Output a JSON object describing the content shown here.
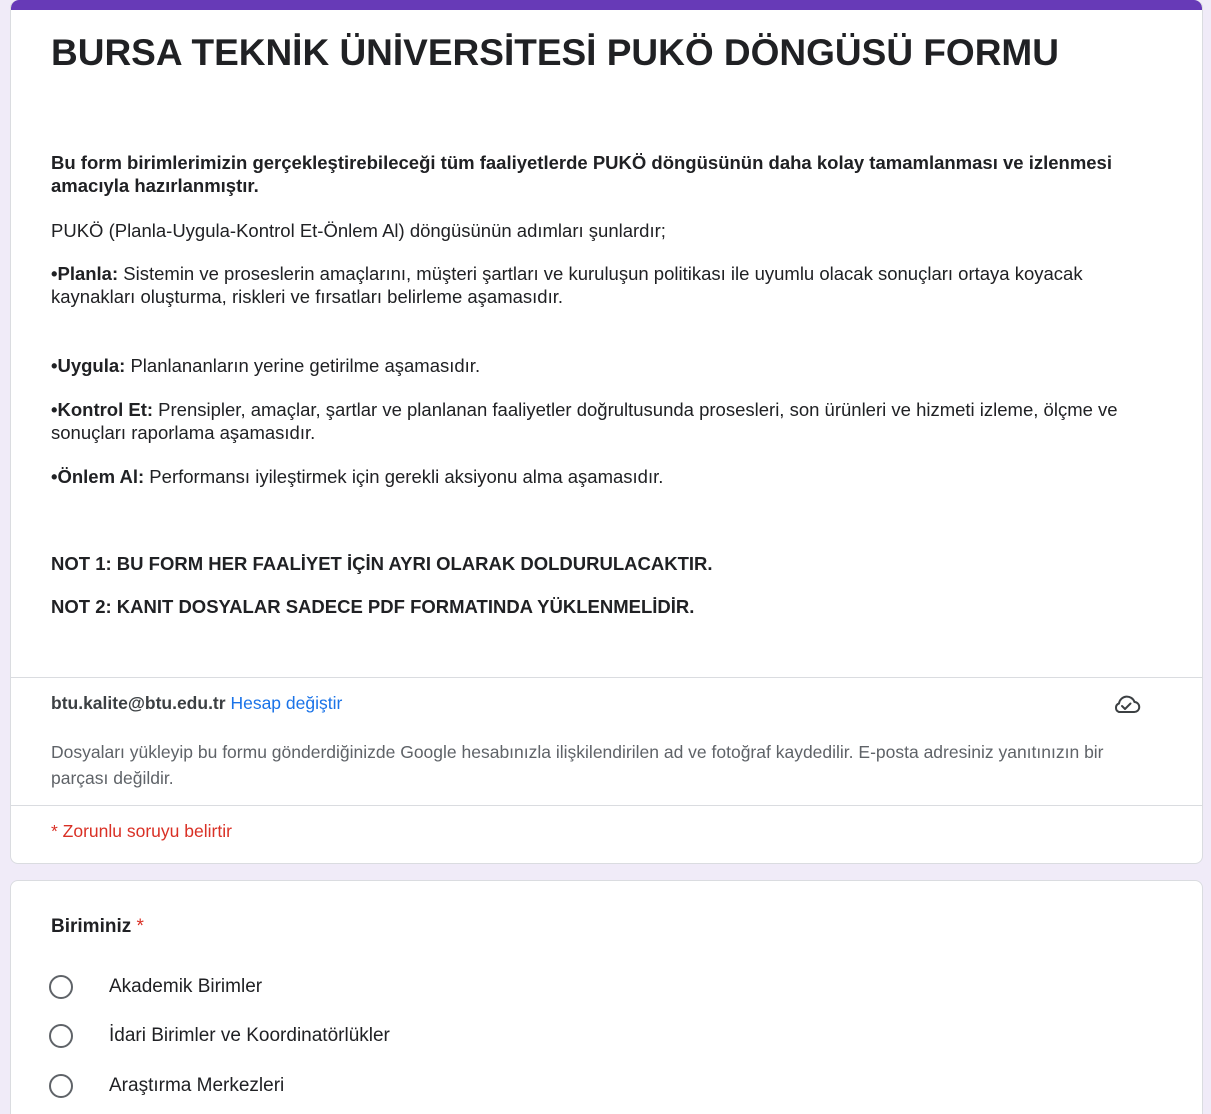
{
  "form": {
    "title": "BURSA TEKNİK ÜNİVERSİTESİ PUKÖ DÖNGÜSÜ FORMU",
    "intro_bold": "Bu form birimlerimizin gerçekleştirebileceği tüm faaliyetlerde PUKÖ döngüsünün daha kolay tamamlanması ve izlenmesi amacıyla hazırlanmıştır.",
    "intro": "PUKÖ (Planla-Uygula-Kontrol Et-Önlem Al) döngüsünün adımları şunlardır;",
    "steps": [
      {
        "label": "•Planla:",
        "text": " Sistemin ve proseslerin amaçlarını, müşteri şartları ve kuruluşun politikası ile uyumlu olacak sonuçları ortaya koyacak kaynakları oluşturma, riskleri ve fırsatları belirleme aşamasıdır."
      },
      {
        "label": "•Uygula:",
        "text": " Planlananların yerine getirilme aşamasıdır."
      },
      {
        "label": "•Kontrol Et:",
        "text": " Prensipler, amaçlar, şartlar ve planlanan faaliyetler doğrultusunda prosesleri, son ürünleri ve hizmeti izleme, ölçme ve sonuçları raporlama aşamasıdır."
      },
      {
        "label": "•Önlem Al:",
        "text": " Performansı iyileştirmek için gerekli aksiyonu alma aşamasıdır."
      }
    ],
    "note1": "NOT 1: BU FORM HER FAALİYET İÇİN AYRI OLARAK DOLDURULACAKTIR.",
    "note2": "NOT 2: KANIT DOSYALAR SADECE PDF FORMATINDA YÜKLENMELİDİR."
  },
  "account": {
    "email": "btu.kalite@btu.edu.tr",
    "switch_label": "Hesap değiştir",
    "status_icon": "cloud-check-icon",
    "privacy_note": "Dosyaları yükleyip bu formu gönderdiğinizde Google hesabınızla ilişkilendirilen ad ve fotoğraf kaydedilir. E-posta adresiniz yanıtınızın bir parçası değildir."
  },
  "required_note": "* Zorunlu soruyu belirtir",
  "question": {
    "title": "Biriminiz",
    "required_mark": "*",
    "options": [
      "Akademik Birimler",
      "İdari Birimler ve Koordinatörlükler",
      "Araştırma Merkezleri"
    ]
  },
  "colors": {
    "accent": "#673ab7",
    "link": "#1a73e8",
    "required": "#d93025",
    "background": "#f0ebf8"
  }
}
